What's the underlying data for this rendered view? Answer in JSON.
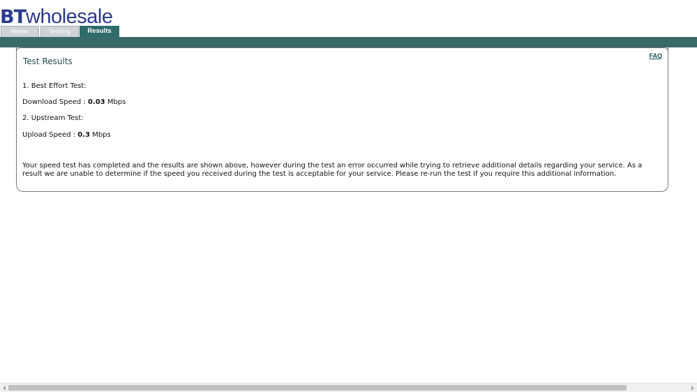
{
  "logo": {
    "bt": "BT",
    "wholesale": "wholesale"
  },
  "tabs": [
    {
      "label": "Home"
    },
    {
      "label": "Testing"
    },
    {
      "label": "Results"
    }
  ],
  "panel": {
    "faq": "FAQ",
    "title": "Test Results",
    "best_effort_heading": "1. Best Effort Test:",
    "download_label": "Download Speed : ",
    "download_value": "0.03",
    "download_unit": " Mbps",
    "upstream_heading": "2. Upstream Test:",
    "upload_label": "Upload Speed : ",
    "upload_value": "0.3",
    "upload_unit": " Mbps",
    "note": "Your speed test has completed and the results are shown above, however during the test an error occurred while trying to retrieve additional details regarding your service. As a result we are unable to determine if the speed you received during the test is acceptable for your service. Please re-run the test if you require this additional information."
  },
  "colors": {
    "brand_blue": "#2a3a8c",
    "header_band": "#396a6a",
    "active_tab": "#2f6b6b"
  },
  "icons": {
    "scroll_left": "chevron-left-icon",
    "scroll_right": "chevron-right-icon"
  }
}
